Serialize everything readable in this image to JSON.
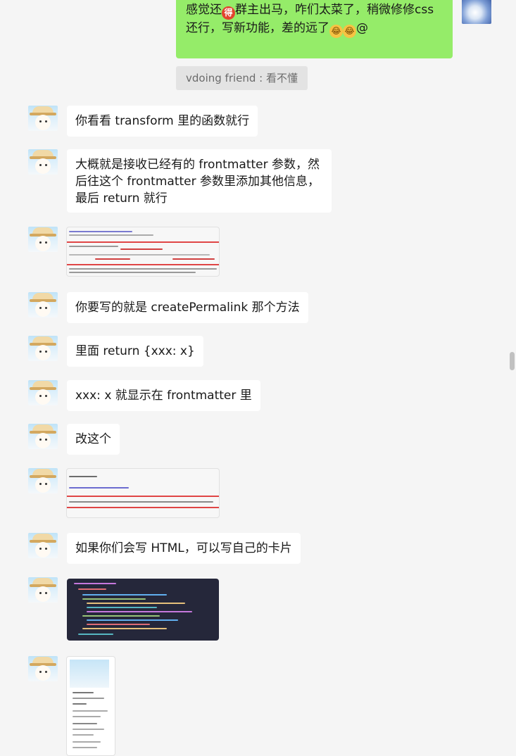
{
  "messages": {
    "self_top": {
      "line1_pre": "感觉还",
      "emoji_de": "得",
      "line1_post": "群主出马，咋们太菜了，稍微修修css",
      "line2": "还行，写新功能，差的远了",
      "emoji_laugh": "laugh-cry-emoji",
      "tail": "@"
    },
    "system_recall": "vdoing friend : 看不懂",
    "m1": "你看看 transform 里的函数就行",
    "m2": "大概就是接收已经有的 frontmatter 参数，然后往这个 frontmatter 参数里添加其他信息，最后 return 就行",
    "m3": "你要写的就是 createPermalink 那个方法",
    "m4": "里面 return {xxx: x}",
    "m5": "xxx: x 就显示在 frontmatter 里",
    "m6": "改这个",
    "m7": "如果你们会写 HTML，可以写自己的卡片"
  },
  "icons": {
    "avatar_other": "sun-hat-character-avatar",
    "avatar_self": "blue-cloud-avatar",
    "screenshot": "code-screenshot-thumbnail"
  },
  "colors": {
    "chat_bg": "#f5f5f5",
    "self_bubble": "#95ec69",
    "other_bubble": "#ffffff",
    "system_bg": "#e3e3e3"
  }
}
